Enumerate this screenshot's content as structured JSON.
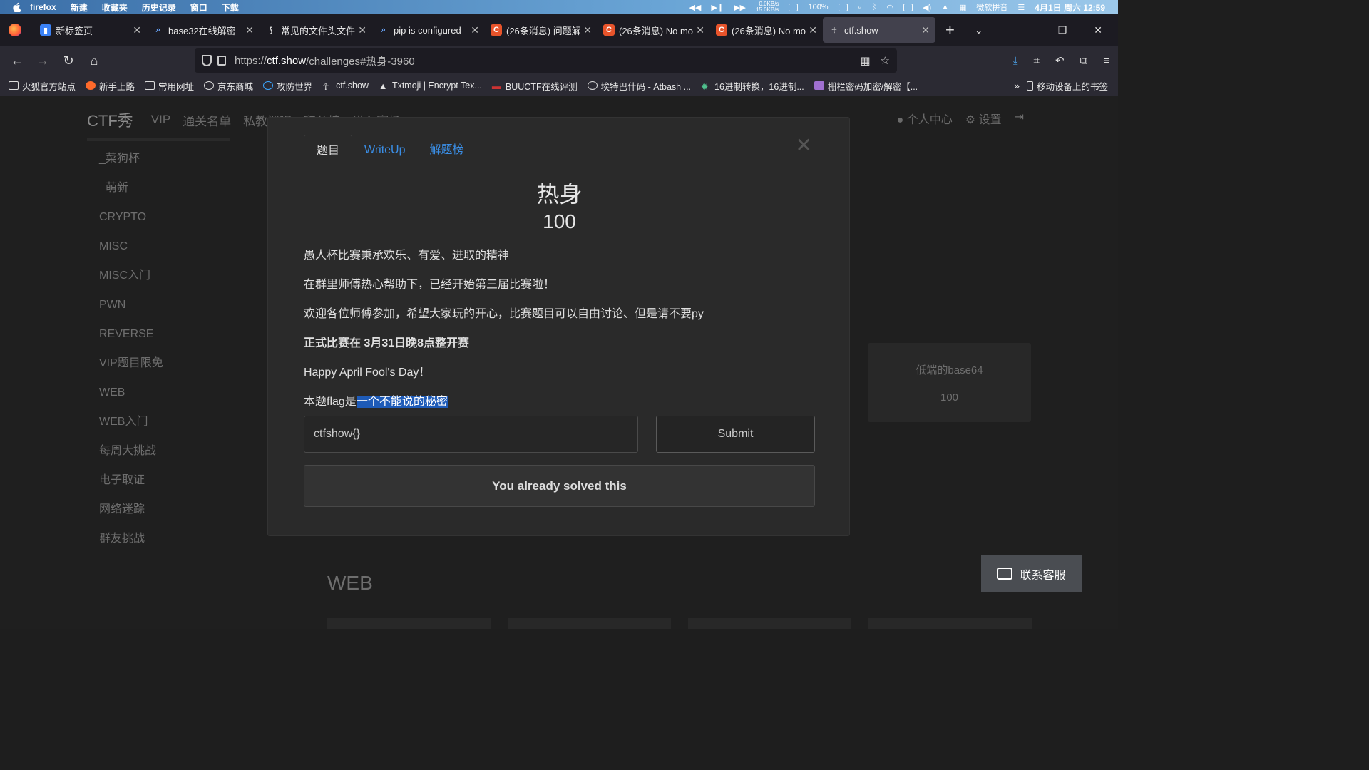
{
  "menubar": {
    "app": "firefox",
    "items": [
      "新建",
      "收藏夹",
      "历史记录",
      "窗口",
      "下载"
    ],
    "netspeed_up": "0.0KB/s",
    "netspeed_down": "15.0KB/s",
    "battery": "100%",
    "ime": "微软拼音",
    "datetime": "4月1日 周六 12:59"
  },
  "tabs": [
    {
      "title": "新标签页",
      "fav_color": "#3b82f6",
      "fav_text": "",
      "active": false
    },
    {
      "title": "base32在线解密",
      "fav_color": "",
      "fav_text": "",
      "active": false
    },
    {
      "title": "常见的文件头文件",
      "fav_color": "",
      "fav_text": "",
      "active": false
    },
    {
      "title": "pip is configured",
      "fav_color": "",
      "fav_text": "",
      "active": false
    },
    {
      "title": "(26条消息) 问题解",
      "fav_color": "#e8542b",
      "fav_text": "C",
      "active": false
    },
    {
      "title": "(26条消息) No mo",
      "fav_color": "#e8542b",
      "fav_text": "C",
      "active": false
    },
    {
      "title": "(26条消息) No mo",
      "fav_color": "#e8542b",
      "fav_text": "C",
      "active": false
    },
    {
      "title": "ctf.show",
      "fav_color": "",
      "fav_text": "",
      "active": true
    }
  ],
  "url": {
    "prefix": "https://",
    "host": "ctf.show",
    "path": "/challenges#热身-3960"
  },
  "bookmarks": [
    "火狐官方站点",
    "新手上路",
    "常用网址",
    "京东商城",
    "攻防世界",
    "ctf.show",
    "Txtmoji | Encrypt Tex...",
    "BUUCTF在线评测",
    "埃特巴什码 - Atbash ...",
    "16进制转换，16进制...",
    "栅栏密码加密/解密【..."
  ],
  "bookmarks_mobile": "移动设备上的书签",
  "site": {
    "logo": "CTF秀",
    "nav": [
      "VIP",
      "通关名单",
      "私教课程",
      "积分榜",
      "进入赛场"
    ],
    "user_center": "个人中心",
    "settings": "设置"
  },
  "sidebar": [
    "_菜狗杯",
    "_萌新",
    "CRYPTO",
    "MISC",
    "MISC入门",
    "PWN",
    "REVERSE",
    "VIP题目限免",
    "WEB",
    "WEB入门",
    "每周大挑战",
    "电子取证",
    "网络迷踪",
    "群友挑战"
  ],
  "card": {
    "name": "低端的base64",
    "points": "100"
  },
  "section_title": "WEB",
  "kefu": "联系客服",
  "modal": {
    "tabs": [
      "题目",
      "WriteUp",
      "解题榜"
    ],
    "title": "热身",
    "points": "100",
    "lines": [
      "愚人杯比赛秉承欢乐、有爱、进取的精神",
      "在群里师傅热心帮助下，已经开始第三届比赛啦！",
      "欢迎各位师傅参加，希望大家玩的开心，比赛题目可以自由讨论、但是请不要py",
      "正式比赛在 3月31日晚8点整开赛",
      "Happy April Fool's Day！"
    ],
    "flag_line_prefix": "本题flag是",
    "flag_line_selected": "一个不能说的秘密",
    "flag_input_value": "ctfshow{}",
    "submit": "Submit",
    "solved": "You already solved this"
  }
}
